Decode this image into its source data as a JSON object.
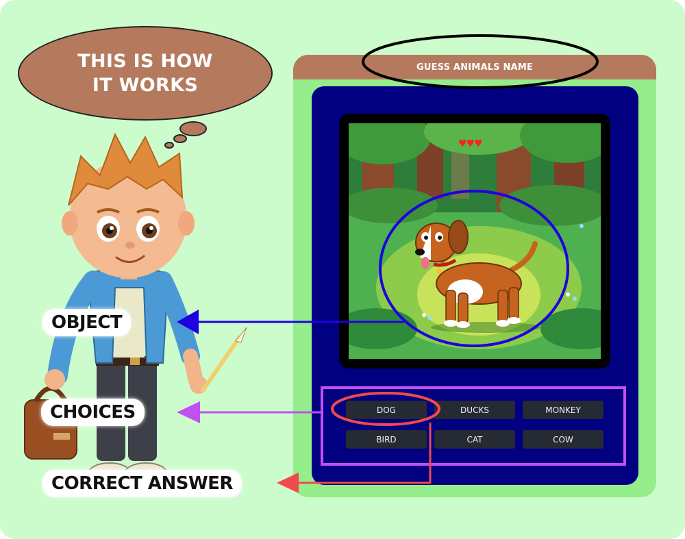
{
  "bubble": {
    "line1": "THIS IS HOW",
    "line2": "IT WORKS"
  },
  "game": {
    "title": "GUESS ANIMALS NAME",
    "lives": "♥♥♥",
    "choices": [
      "DOG",
      "DUCKS",
      "MONKEY",
      "BIRD",
      "CAT",
      "COW"
    ]
  },
  "callouts": {
    "object": "OBJECT",
    "choices": "CHOICES",
    "correct_answer": "CORRECT ANSWER"
  },
  "colors": {
    "background": "#ccfccb",
    "card_outer": "#96ed8c",
    "card_header": "#b57a5e",
    "card_inner": "#000080",
    "button": "#262a33",
    "object_arrow": "#1f00e0",
    "choices_arrow": "#c050f0",
    "answer_arrow": "#f04a4a"
  },
  "icons": [
    "heart-icon",
    "dog-illustration",
    "boy-illustration",
    "arrow-left-icon"
  ]
}
